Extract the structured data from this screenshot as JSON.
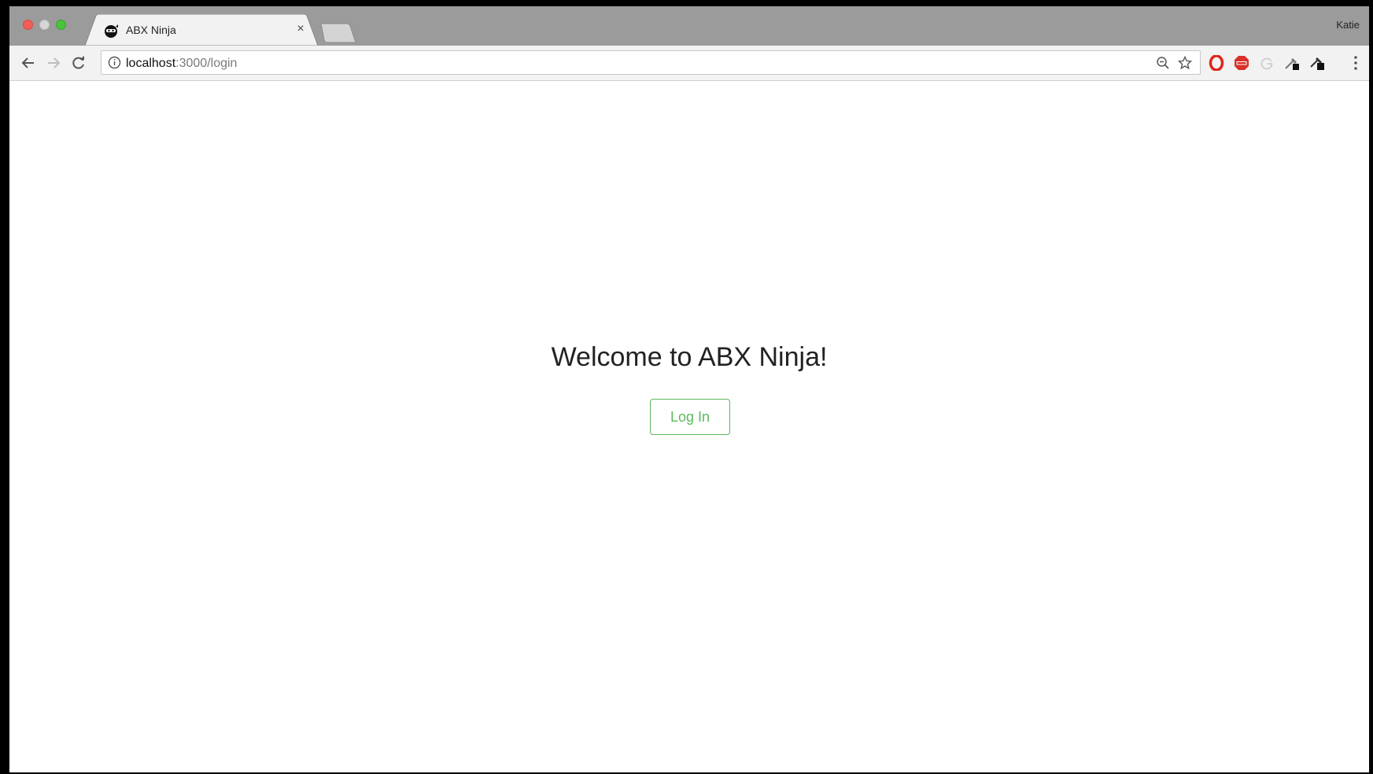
{
  "browser": {
    "tab": {
      "title": "ABX Ninja",
      "close_glyph": "×"
    },
    "profile_name": "Katie",
    "address_bar": {
      "host": "localhost",
      "path": ":3000/login"
    },
    "icons": [
      "back-arrow-icon",
      "forward-arrow-icon",
      "reload-icon",
      "info-icon",
      "zoom-out-icon",
      "star-icon",
      "opera-icon",
      "adblock-plus-icon",
      "google-icon",
      "dropper-icon",
      "menu-dots-icon"
    ],
    "colors": {
      "frame": "#9b9b9b",
      "toolbar": "#f2f2f2",
      "close_light": "#f25e57",
      "zoom_light": "#4cc23c"
    }
  },
  "page": {
    "heading": "Welcome to ABX Ninja!",
    "login_button": "Log In",
    "colors": {
      "button": "#5cb85c",
      "heading": "#222222"
    }
  }
}
